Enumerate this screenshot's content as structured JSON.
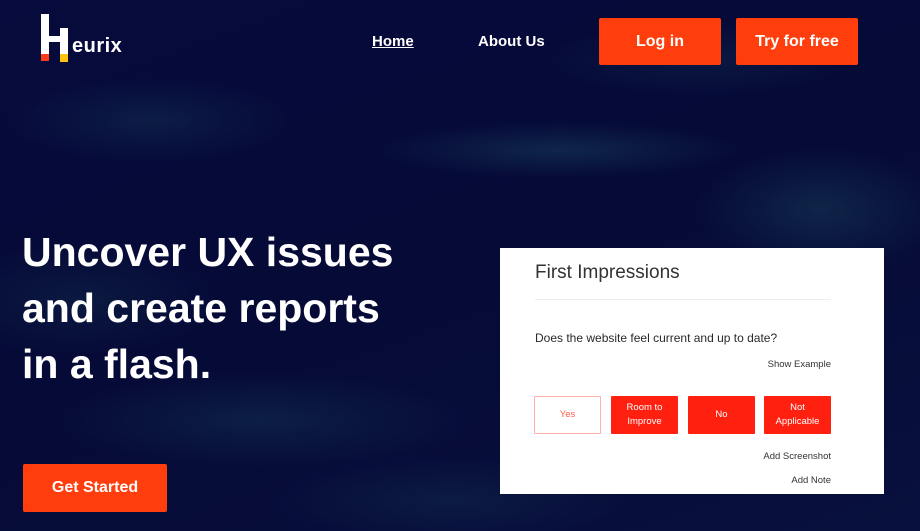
{
  "brand": {
    "name": "eurix",
    "logo_letter": "H",
    "accent_color": "#ff3d0d",
    "secondary_accent": "#ffc20e"
  },
  "nav": {
    "links": [
      {
        "label": "Home",
        "active": true
      },
      {
        "label": "About Us",
        "active": false
      }
    ],
    "login_label": "Log in",
    "try_label": "Try for free"
  },
  "hero": {
    "title_lines": [
      "Uncover UX issues",
      "and create reports",
      "in a flash."
    ],
    "cta_label": "Get Started"
  },
  "card": {
    "title": "First Impressions",
    "question": "Does the website feel current and up to date?",
    "show_example": "Show Example",
    "options": [
      {
        "label": "Yes",
        "selected": false
      },
      {
        "label": "Room to Improve",
        "selected": true
      },
      {
        "label": "No",
        "selected": true
      },
      {
        "label": "Not Applicable",
        "selected": true
      }
    ],
    "add_screenshot": "Add Screenshot",
    "add_note": "Add Note"
  }
}
